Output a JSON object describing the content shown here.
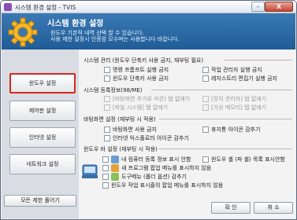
{
  "window": {
    "title": "시스템 환경 설정 - TVIS",
    "min_glyph": "–",
    "close_glyph": "X"
  },
  "header": {
    "title": "시스템 환경 설정",
    "desc1": "윈도우 기본적 내역 선택 할 수 있습니다.",
    "desc2": "사용 제한 설정시 인증암 모수며는 사용합니다 바랍니다."
  },
  "sidebar": {
    "items": [
      {
        "label": "윈도우 설정"
      },
      {
        "label": "제어판 설정"
      },
      {
        "label": "인터넷 설정"
      },
      {
        "label": "네트워크 설정"
      }
    ],
    "reset_label": "모든 제한 풀어기"
  },
  "sections": {
    "system": {
      "title": "시스템 관리 (윈도우 단축키 사용 금지, 재부팅 필요)",
      "items": [
        "명령 프롬프트 실행 금지",
        "작업 관리자 실행 금지",
        "윈도우 단축키 사용 금지",
        "레지스트리 편집기 실행 금지"
      ]
    },
    "desktop": {
      "title": "시스템 등록정보(98/ME)",
      "items": [
        "[바탕화면 추가유 마관] 탭 없애기",
        "[장치 관리자] 탭 없애기",
        "[파일 시스템] 탭 없애기",
        "[가상 메모리] 탭 없애기"
      ]
    },
    "display": {
      "title": "바탕화면 설정 (재부팅 시 적용)",
      "items": [
        "바탕화면 사용 금지",
        "휴지통 아이콘 감추기",
        "인터넷 익스플로러 아이콘 감추기"
      ]
    },
    "taskbar": {
      "title": "윈도우 바 설정 (재부팅 시 적용)",
      "items": [
        "내 컴퓨터 등록 정보 표시 안함",
        "윈도우 셸 (파 셸) 목록 표시안함",
        "새 프로그램 팝업 메뉴를 표시하지 않음",
        "도구메뉴 (폴더 옵션) 감추기",
        "윈도우 작업 표시줄의 팝업 메뉴를 표시하지 않음"
      ]
    }
  },
  "buttons": {
    "ok": "확 인",
    "cancel": "취 소"
  },
  "colors": {
    "header": "#2e6aa6",
    "active_outline": "#d42a22",
    "sidebar": "#d9dde3"
  },
  "icons": [
    "app-icon",
    "gear-icon",
    "taskbar-tray-icon",
    "item-icon-computer",
    "item-icon-program",
    "item-icon-tools"
  ]
}
